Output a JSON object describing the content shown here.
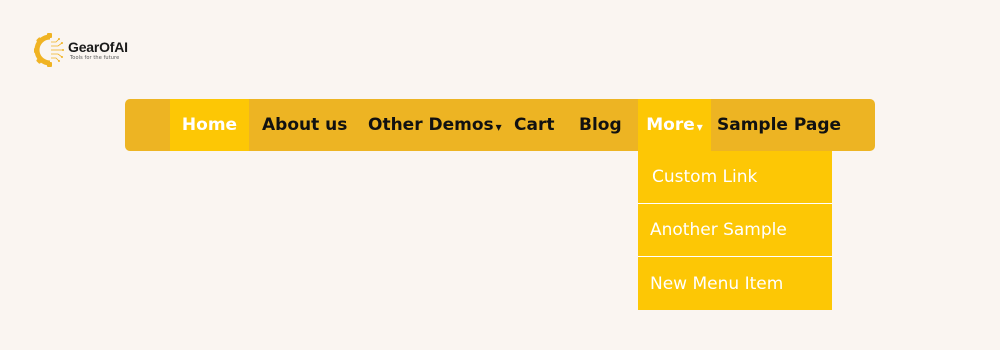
{
  "logo": {
    "name": "GearOfAI",
    "tagline": "Tools for the future",
    "accent_color": "#f0b323",
    "icon": "gear-icon"
  },
  "nav": {
    "items": [
      {
        "label": "Home",
        "active": true
      },
      {
        "label": "About us"
      },
      {
        "label": "Other Demos",
        "has_dropdown": true
      },
      {
        "label": "Cart"
      },
      {
        "label": "Blog"
      },
      {
        "label": "More",
        "has_dropdown": true,
        "active": true
      },
      {
        "label": "Sample Page"
      }
    ],
    "caret": "▾"
  },
  "dropdown": {
    "items": [
      {
        "label": "Custom Link"
      },
      {
        "label": "Another Sample"
      },
      {
        "label": "New Menu Item"
      }
    ]
  },
  "colors": {
    "background": "#faf5f1",
    "navbar": "#edb423",
    "active": "#fdc705",
    "active_text": "#ffffff",
    "text": "#111111"
  }
}
